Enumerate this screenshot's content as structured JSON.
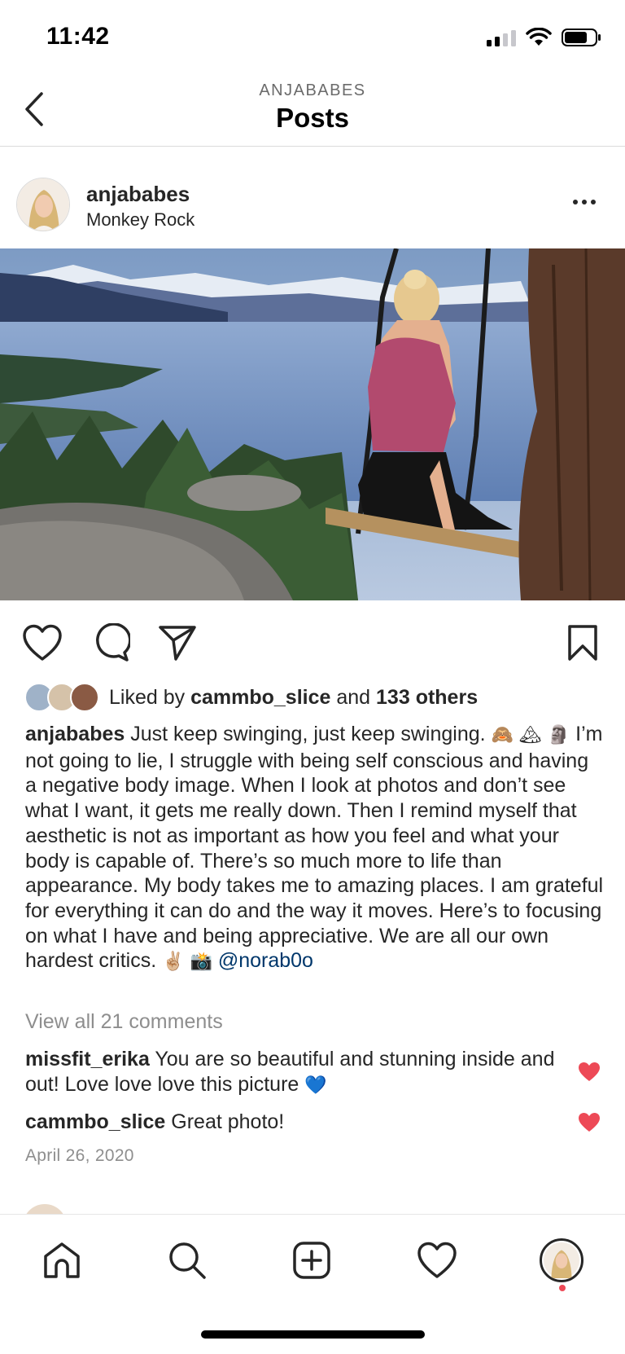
{
  "status_bar": {
    "time": "11:42",
    "signal_bars": 2,
    "battery_level": 0.7
  },
  "nav": {
    "subtitle": "ANJABABES",
    "title": "Posts"
  },
  "post": {
    "username": "anjababes",
    "location": "Monkey Rock",
    "likes": {
      "prefix": "Liked by",
      "user": "cammbo_slice",
      "conjunction": "and",
      "others": "133 others"
    },
    "caption": {
      "username": "anjababes",
      "text_1": " Just keep swinging, just keep swinging. ",
      "emoji_1": "🙈",
      "emoji_2": "🏔",
      "emoji_3": "🗿",
      "text_2": " I’m not going to lie, I struggle with being self conscious and having a negative body image. When I look at photos and don’t see what I want, it gets me really down. Then I remind myself that aesthetic is not as important as how you feel and what your body is capable of. There’s so much more to life than appearance. My body takes me to amazing places. I am grateful for everything it can do and the way it moves. Here’s to focusing on what I have and being appreciative. We are all our own hardest critics. ",
      "emoji_4": "✌🏼",
      "emoji_5": "📸",
      "mention": "@norab0o"
    },
    "view_comments": "View all 21 comments",
    "comments": [
      {
        "username": "missfit_erika",
        "text": " You are so beautiful and stunning inside and out! Love love love this picture ",
        "emoji": "💙",
        "liked": true
      },
      {
        "username": "cammbo_slice",
        "text": " Great photo!",
        "liked": true
      }
    ],
    "date": "April 26, 2020"
  },
  "colors": {
    "like_red": "#ed4956",
    "mention_blue": "#00376b",
    "muted": "#8e8e8e",
    "text": "#262626"
  },
  "icons": {
    "back": "chevron-left-icon",
    "more": "more-dots-icon",
    "like": "heart-icon",
    "comment": "comment-bubble-icon",
    "share": "paper-plane-icon",
    "save": "bookmark-icon",
    "tab_home": "home-icon",
    "tab_search": "search-icon",
    "tab_new": "add-post-icon",
    "tab_activity": "heart-icon",
    "tab_profile": "profile-avatar"
  }
}
